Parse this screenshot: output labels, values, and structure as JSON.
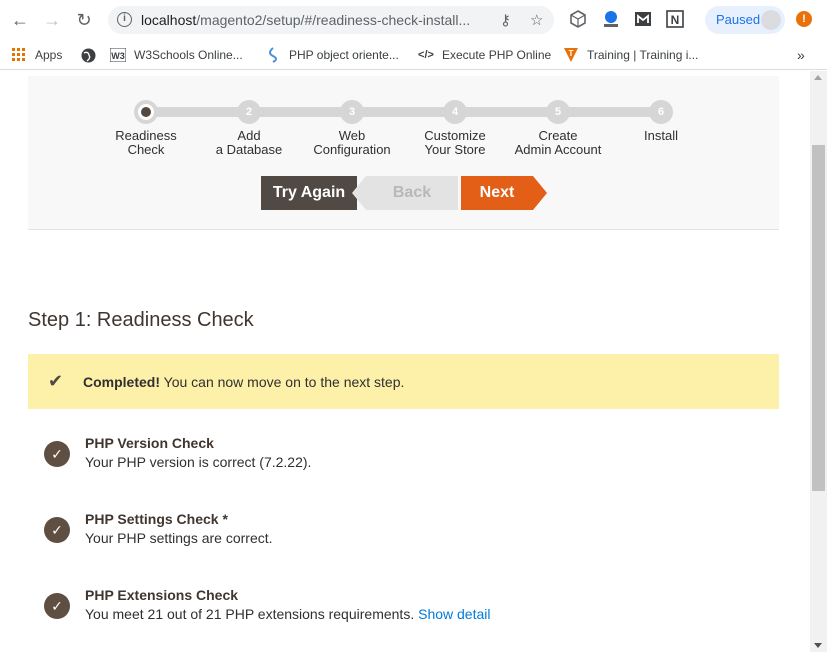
{
  "browser": {
    "url_host": "localhost",
    "url_path": "/magento2/setup/#/readiness-check-install...",
    "profile_status": "Paused"
  },
  "bookmarks": [
    {
      "label": "Apps",
      "icon": "apps-grid-icon"
    },
    {
      "label": "",
      "icon": "globe-icon"
    },
    {
      "label": "W3Schools Online...",
      "icon": "w3schools-icon"
    },
    {
      "label": "PHP object oriente...",
      "icon": "php-icon"
    },
    {
      "label": "Execute PHP Online",
      "icon": "code-icon"
    },
    {
      "label": "Training | Training i...",
      "icon": "training-icon"
    }
  ],
  "wizard": {
    "steps": [
      {
        "num": "1",
        "line1": "Readiness",
        "line2": "Check",
        "active": true
      },
      {
        "num": "2",
        "line1": "Add",
        "line2": "a Database"
      },
      {
        "num": "3",
        "line1": "Web",
        "line2": "Configuration"
      },
      {
        "num": "4",
        "line1": "Customize",
        "line2": "Your Store"
      },
      {
        "num": "5",
        "line1": "Create",
        "line2": "Admin Account"
      },
      {
        "num": "6",
        "line1": "Install",
        "line2": ""
      }
    ],
    "buttons": {
      "try_again": "Try Again",
      "back": "Back",
      "next": "Next"
    }
  },
  "main": {
    "step_title": "Step 1: Readiness Check",
    "notice_bold": "Completed!",
    "notice_text": " You can now move on to the next step.",
    "checks": [
      {
        "title": "PHP Version Check",
        "desc": "Your PHP version is correct (7.2.22).",
        "link": ""
      },
      {
        "title": "PHP Settings Check *",
        "desc": "Your PHP settings are correct.",
        "link": ""
      },
      {
        "title": "PHP Extensions Check",
        "desc": "You meet 21 out of 21 PHP extensions requirements. ",
        "link": "Show detail"
      }
    ]
  }
}
